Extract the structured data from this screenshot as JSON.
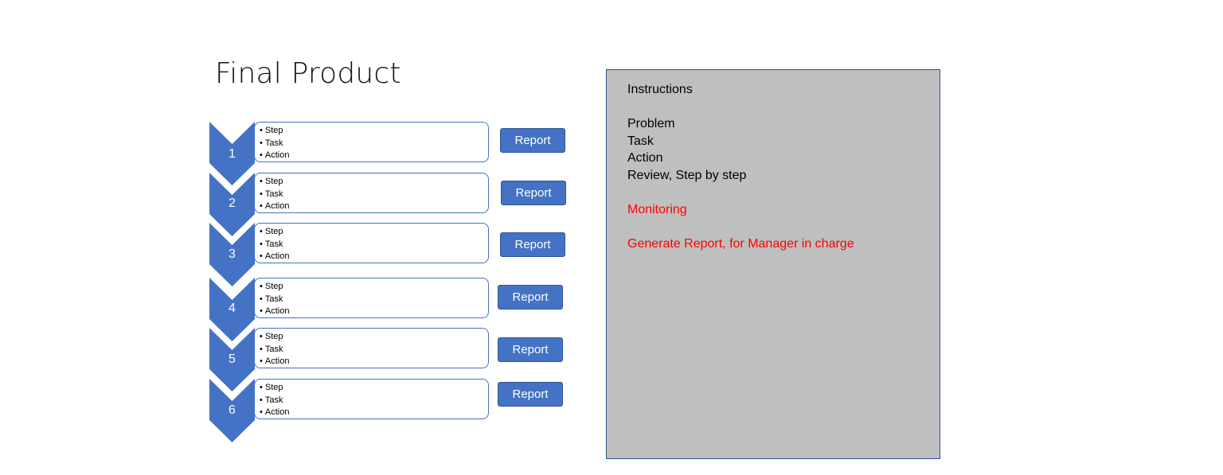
{
  "title": "Final Product",
  "steps": [
    {
      "number": "1",
      "bullets": [
        "Step",
        "Task",
        "Action"
      ],
      "report_label": "Report"
    },
    {
      "number": "2",
      "bullets": [
        "Step",
        "Task",
        "Action"
      ],
      "report_label": "Report"
    },
    {
      "number": "3",
      "bullets": [
        "Step",
        "Task",
        "Action"
      ],
      "report_label": "Report"
    },
    {
      "number": "4",
      "bullets": [
        "Step",
        "Task",
        "Action"
      ],
      "report_label": "Report"
    },
    {
      "number": "5",
      "bullets": [
        "Step",
        "Task",
        "Action"
      ],
      "report_label": "Report"
    },
    {
      "number": "6",
      "bullets": [
        "Step",
        "Task",
        "Action"
      ],
      "report_label": "Report"
    }
  ],
  "panel": {
    "heading": "Instructions",
    "items": [
      "Problem",
      "Task",
      "Action",
      "Review, Step by step"
    ],
    "monitoring": "Monitoring",
    "generate": "Generate Report, for Manager in charge"
  },
  "colors": {
    "chevron": "#4472c4",
    "button": "#4472c4",
    "panel_bg": "#bfbfbf",
    "highlight": "#ff0000"
  }
}
